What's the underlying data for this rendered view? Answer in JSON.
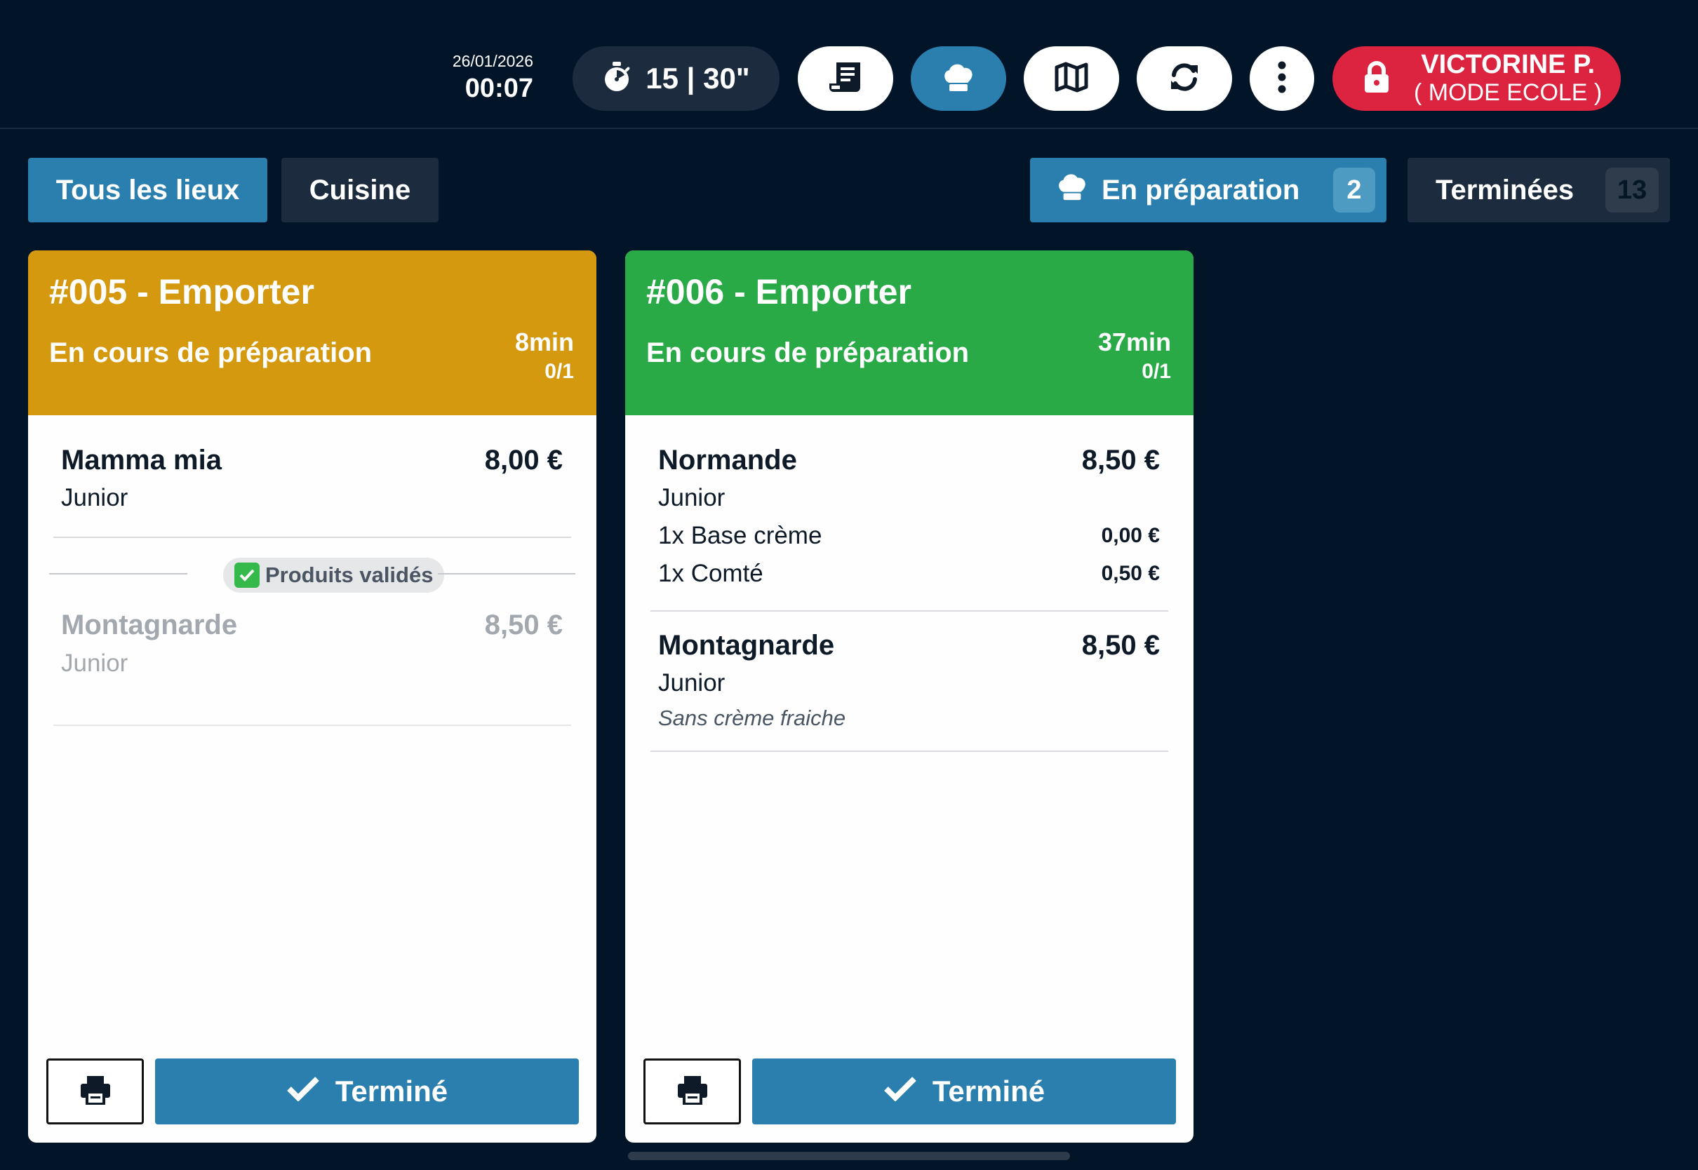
{
  "header": {
    "date": "26/01/2026",
    "time": "00:07",
    "timer": "15 | 30\"",
    "user_name": "VICTORINE P.",
    "user_mode": "( MODE ECOLE )"
  },
  "icons": {
    "timer": "stopwatch-icon",
    "ticket": "receipt-icon",
    "chef": "chef-hat-icon",
    "map": "map-icon",
    "sync": "sync-icon",
    "more": "more-vertical-icon",
    "lock": "lock-icon",
    "print": "printer-icon",
    "check": "check-icon"
  },
  "colors": {
    "background": "#021428",
    "accent_blue": "#2a7fae",
    "card_late": "#d4990e",
    "card_ok": "#29aa47",
    "user_red": "#dc2340"
  },
  "filters": {
    "all_places": "Tous les lieux",
    "kitchen": "Cuisine",
    "in_prep_label": "En préparation",
    "in_prep_count": "2",
    "done_label": "Terminées",
    "done_count": "13"
  },
  "orders": [
    {
      "title": "#005 - Emporter",
      "status": "En cours de préparation",
      "elapsed": "8min",
      "progress": "0/1",
      "items": [
        {
          "name": "Mamma mia",
          "price": "8,00 €",
          "size": "Junior"
        }
      ],
      "validated_label": "Produits validés",
      "validated_items": [
        {
          "name": "Montagnarde",
          "price": "8,50 €",
          "size": "Junior"
        }
      ],
      "done_label": "Terminé"
    },
    {
      "title": "#006 - Emporter",
      "status": "En cours de préparation",
      "elapsed": "37min",
      "progress": "0/1",
      "items": [
        {
          "name": "Normande",
          "price": "8,50 €",
          "size": "Junior",
          "options": [
            {
              "label": "1x Base crème",
              "price": "0,00 €"
            },
            {
              "label": "1x Comté",
              "price": "0,50 €"
            }
          ]
        },
        {
          "name": "Montagnarde",
          "price": "8,50 €",
          "size": "Junior",
          "note": "Sans crème fraiche"
        }
      ],
      "done_label": "Terminé"
    }
  ]
}
